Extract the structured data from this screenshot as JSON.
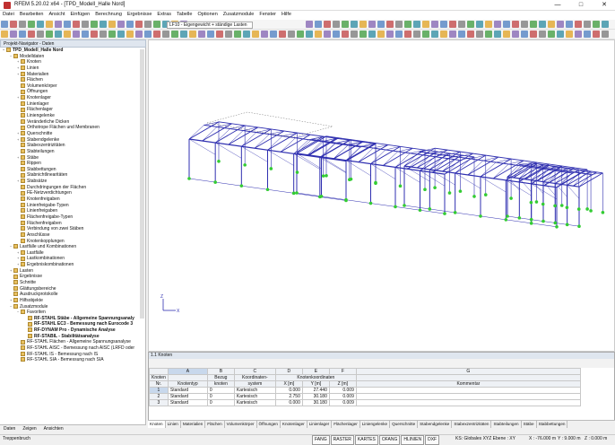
{
  "window": {
    "title": "RFEM 5.20.02 x64 - [TPD_Modell_Halle Nord]",
    "minimize": "—",
    "maximize": "□",
    "close": "✕"
  },
  "menu": [
    "Datei",
    "Bearbeiten",
    "Ansicht",
    "Einfügen",
    "Berechnung",
    "Ergebnisse",
    "Extras",
    "Tabelle",
    "Optionen",
    "Zusatzmodule",
    "Fenster",
    "Hilfe"
  ],
  "toolbar": {
    "loadcase": "LF10 - Eigengewicht + ständige Lasten"
  },
  "navigator": {
    "title": "Projekt-Navigator - Daten",
    "items": [
      {
        "label": "TPD_Modell_Halle Nord",
        "level": 0,
        "bold": true,
        "exp": "−"
      },
      {
        "label": "Modelldaten",
        "level": 1,
        "exp": "−"
      },
      {
        "label": "Knoten",
        "level": 2,
        "exp": "+"
      },
      {
        "label": "Linien",
        "level": 2,
        "exp": "+"
      },
      {
        "label": "Materialien",
        "level": 2,
        "exp": "+"
      },
      {
        "label": "Flächen",
        "level": 2,
        "exp": ""
      },
      {
        "label": "Volumenkörper",
        "level": 2,
        "exp": ""
      },
      {
        "label": "Öffnungen",
        "level": 2,
        "exp": ""
      },
      {
        "label": "Knotenlager",
        "level": 2,
        "exp": "+"
      },
      {
        "label": "Linienlager",
        "level": 2,
        "exp": ""
      },
      {
        "label": "Flächenlager",
        "level": 2,
        "exp": ""
      },
      {
        "label": "Liniengelenke",
        "level": 2,
        "exp": ""
      },
      {
        "label": "Veränderliche Dicken",
        "level": 2,
        "exp": ""
      },
      {
        "label": "Orthotrope Flächen und Membranen",
        "level": 2,
        "exp": ""
      },
      {
        "label": "Querschnitte",
        "level": 2,
        "exp": "+"
      },
      {
        "label": "Stabendgelenke",
        "level": 2,
        "exp": "+"
      },
      {
        "label": "Stabexzentrizitäten",
        "level": 2,
        "exp": ""
      },
      {
        "label": "Stabteilungen",
        "level": 2,
        "exp": ""
      },
      {
        "label": "Stäbe",
        "level": 2,
        "exp": "+"
      },
      {
        "label": "Rippen",
        "level": 2,
        "exp": ""
      },
      {
        "label": "Stabbettungen",
        "level": 2,
        "exp": ""
      },
      {
        "label": "Stabnichtlinearitäten",
        "level": 2,
        "exp": ""
      },
      {
        "label": "Stabsätze",
        "level": 2,
        "exp": "+"
      },
      {
        "label": "Durchdringungen der Flächen",
        "level": 2,
        "exp": ""
      },
      {
        "label": "FE-Netzverdichtungen",
        "level": 2,
        "exp": ""
      },
      {
        "label": "Knotenfreigaben",
        "level": 2,
        "exp": ""
      },
      {
        "label": "Linienfreigabe-Typen",
        "level": 2,
        "exp": ""
      },
      {
        "label": "Linienfreigaben",
        "level": 2,
        "exp": ""
      },
      {
        "label": "Flächenfreigabe-Typen",
        "level": 2,
        "exp": ""
      },
      {
        "label": "Flächenfreigaben",
        "level": 2,
        "exp": ""
      },
      {
        "label": "Verbindung von zwei Stäben",
        "level": 2,
        "exp": ""
      },
      {
        "label": "Anschlüsse",
        "level": 2,
        "exp": ""
      },
      {
        "label": "Knotenkopplungen",
        "level": 2,
        "exp": ""
      },
      {
        "label": "Lastfälle und Kombinationen",
        "level": 1,
        "exp": "−"
      },
      {
        "label": "Lastfälle",
        "level": 2,
        "exp": "+"
      },
      {
        "label": "Lastkombinationen",
        "level": 2,
        "exp": "+"
      },
      {
        "label": "Ergebniskombinationen",
        "level": 2,
        "exp": "+"
      },
      {
        "label": "Lasten",
        "level": 1,
        "exp": "+"
      },
      {
        "label": "Ergebnisse",
        "level": 1,
        "exp": ""
      },
      {
        "label": "Schnitte",
        "level": 1,
        "exp": ""
      },
      {
        "label": "Glättungsbereiche",
        "level": 1,
        "exp": ""
      },
      {
        "label": "Ausdruckprotokolle",
        "level": 1,
        "exp": ""
      },
      {
        "label": "Hilfsobjekte",
        "level": 1,
        "exp": "+"
      },
      {
        "label": "Zusatzmodule",
        "level": 1,
        "exp": "−"
      },
      {
        "label": "Favoriten",
        "level": 2,
        "exp": "−"
      },
      {
        "label": "RF-STAHL Stäbe - Allgemeine Spannungsanaly",
        "level": 3,
        "exp": "",
        "bold": true
      },
      {
        "label": "RF-STAHL EC3 - Bemessung nach Eurocode 3",
        "level": 3,
        "exp": "",
        "bold": true
      },
      {
        "label": "RF-DYNAM Pro - Dynamische Analyse",
        "level": 3,
        "exp": "",
        "bold": true
      },
      {
        "label": "RF-STABIL - Stabilitätsanalyse",
        "level": 3,
        "exp": "",
        "bold": true
      },
      {
        "label": "RF-STAHL Flächen - Allgemeine Spannungsanalyse",
        "level": 2,
        "exp": ""
      },
      {
        "label": "RF-STAHL AISC - Bemessung nach AISC (LRFD oder",
        "level": 2,
        "exp": ""
      },
      {
        "label": "RF-STAHL IS - Bemessung nach IS",
        "level": 2,
        "exp": ""
      },
      {
        "label": "RF-STAHL SIA - Bemessung nach SIA",
        "level": 2,
        "exp": ""
      }
    ],
    "tabs": [
      "Daten",
      "Zeigen",
      "Ansichten"
    ]
  },
  "table": {
    "title": "1.1 Knoten",
    "cols": [
      "A",
      "B",
      "C",
      "D",
      "E",
      "F",
      "G"
    ],
    "h1": [
      "Knoten",
      "Bezug",
      "Koordinaten-",
      "Knotenkoordinaten",
      "Kommentar"
    ],
    "h2": [
      "Nr.",
      "Knotentyp",
      "knoten",
      "system",
      "X [m]",
      "Y [m]",
      "Z [m]"
    ],
    "rows": [
      [
        "1",
        "Standard",
        "0",
        "Kartesisch",
        "0.000",
        "27.440",
        "0.009",
        ""
      ],
      [
        "2",
        "Standard",
        "0",
        "Kartesisch",
        "2.750",
        "30.180",
        "0.009",
        ""
      ],
      [
        "3",
        "Standard",
        "0",
        "Kartesisch",
        "0.000",
        "30.180",
        "0.009",
        ""
      ]
    ],
    "sheets": [
      "Knoten",
      "Linien",
      "Materialien",
      "Flächen",
      "Volumenkörper",
      "Öffnungen",
      "Knotenlager",
      "Linienlager",
      "Flächenlager",
      "Liniengelenke",
      "Querschnitte",
      "Stabendgelenke",
      "Stabexzentrizitäten",
      "Stabteilungen",
      "Stäbe",
      "Stabbettungen"
    ]
  },
  "status": {
    "left": "Treppenbruch",
    "buttons": [
      "FANG",
      "RASTER",
      "KARTES",
      "OFANG",
      "HLINIEN",
      "DXF"
    ],
    "coord": "KS: Globales XYZ Ebene : XY",
    "x": "X : -76.000 m",
    "y": "Y : 9.000 m",
    "z": "Z : 0.000 m"
  },
  "axes": {
    "x": "X",
    "z": "Z"
  },
  "colors": {
    "steel": "#2f2fb0",
    "support": "#33cc33",
    "accent": "#0078d7"
  }
}
